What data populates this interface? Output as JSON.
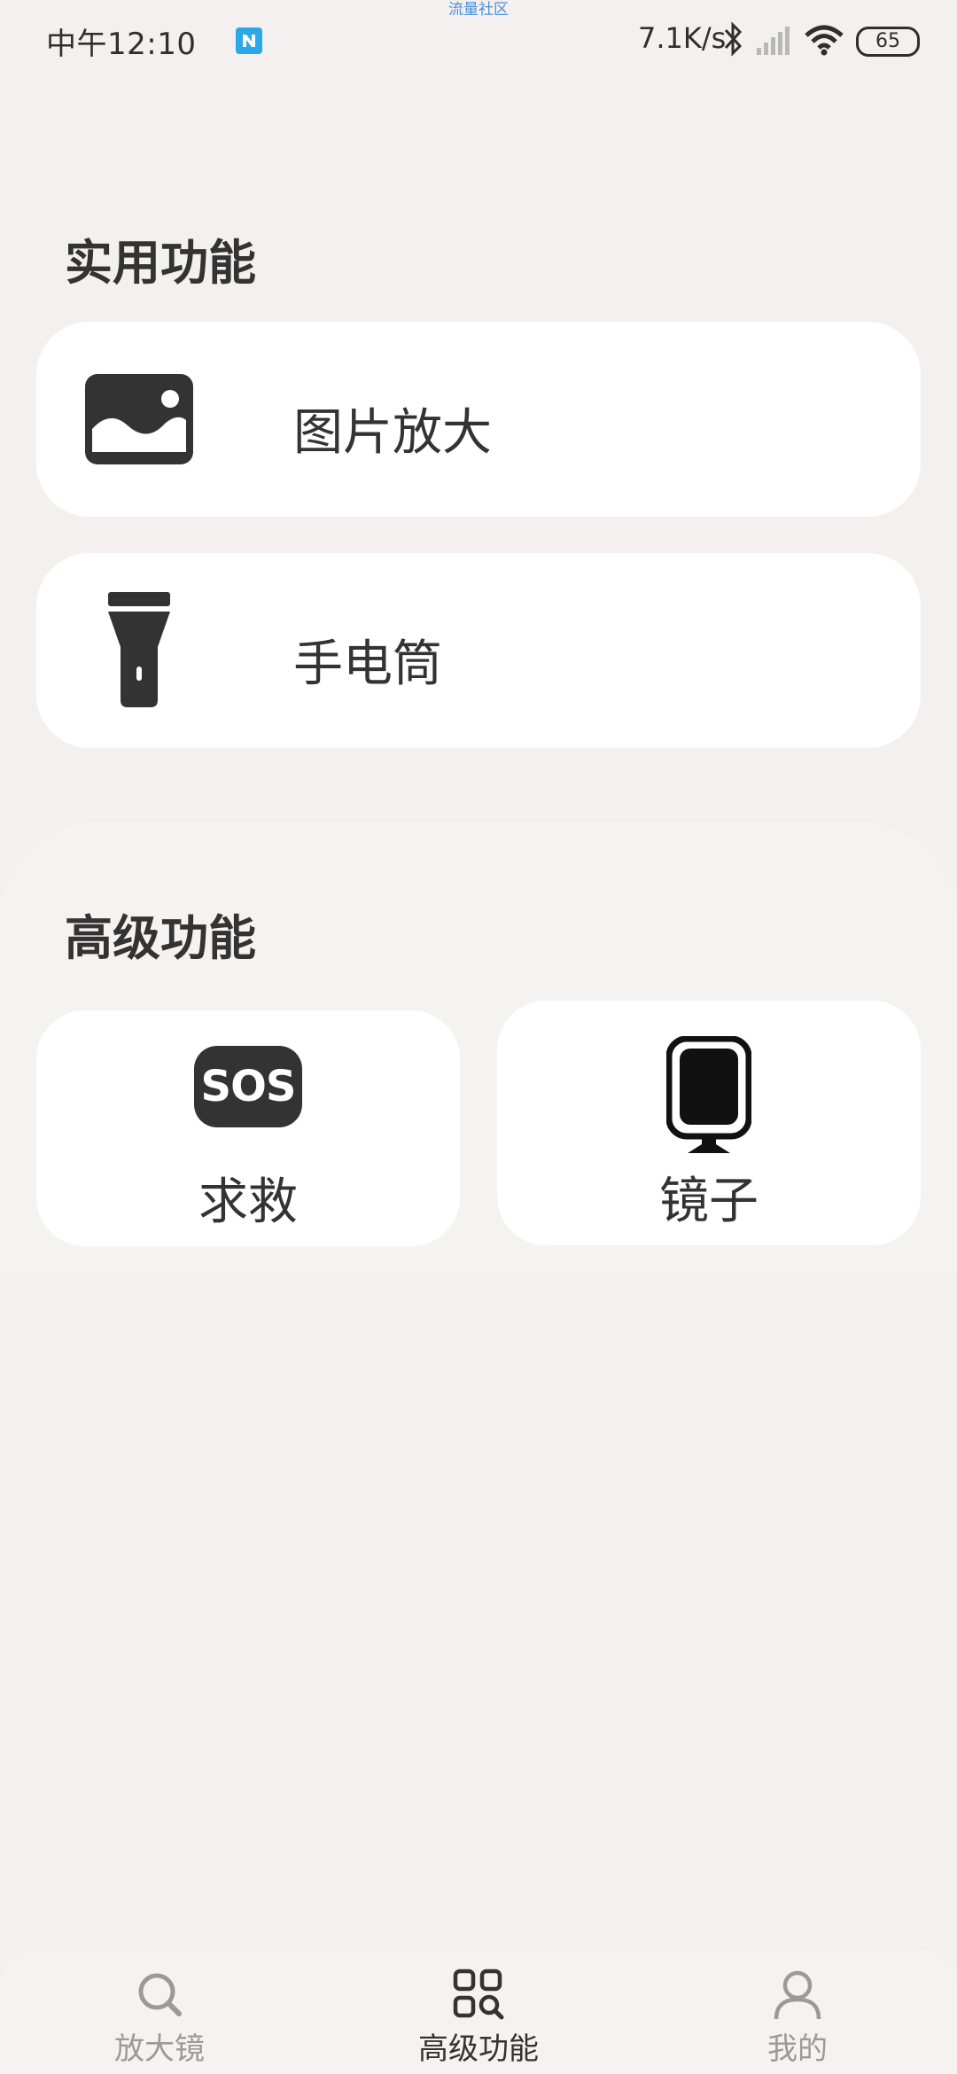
{
  "status_bar": {
    "time": "中午12:10",
    "carrier_text": "流量社区",
    "net_speed": "7.1K/s",
    "battery": "65"
  },
  "sections": {
    "practical": {
      "title": "实用功能",
      "items": [
        {
          "label": "图片放大",
          "icon": "image-icon"
        },
        {
          "label": "手电筒",
          "icon": "flashlight-icon"
        }
      ]
    },
    "advanced": {
      "title": "高级功能",
      "items": [
        {
          "label": "求救",
          "icon": "sos-icon",
          "icon_text": "SOS"
        },
        {
          "label": "镜子",
          "icon": "mirror-icon"
        }
      ]
    }
  },
  "bottom_nav": {
    "items": [
      {
        "label": "放大镜",
        "icon": "search-icon",
        "active": false
      },
      {
        "label": "高级功能",
        "icon": "grid-search-icon",
        "active": true
      },
      {
        "label": "我的",
        "icon": "user-icon",
        "active": false
      }
    ]
  },
  "colors": {
    "background": "#f3f0ef",
    "card": "#ffffff",
    "text": "#333333",
    "nav_inactive": "#9a9a9a",
    "accent_notif": "#2aa8e8"
  }
}
